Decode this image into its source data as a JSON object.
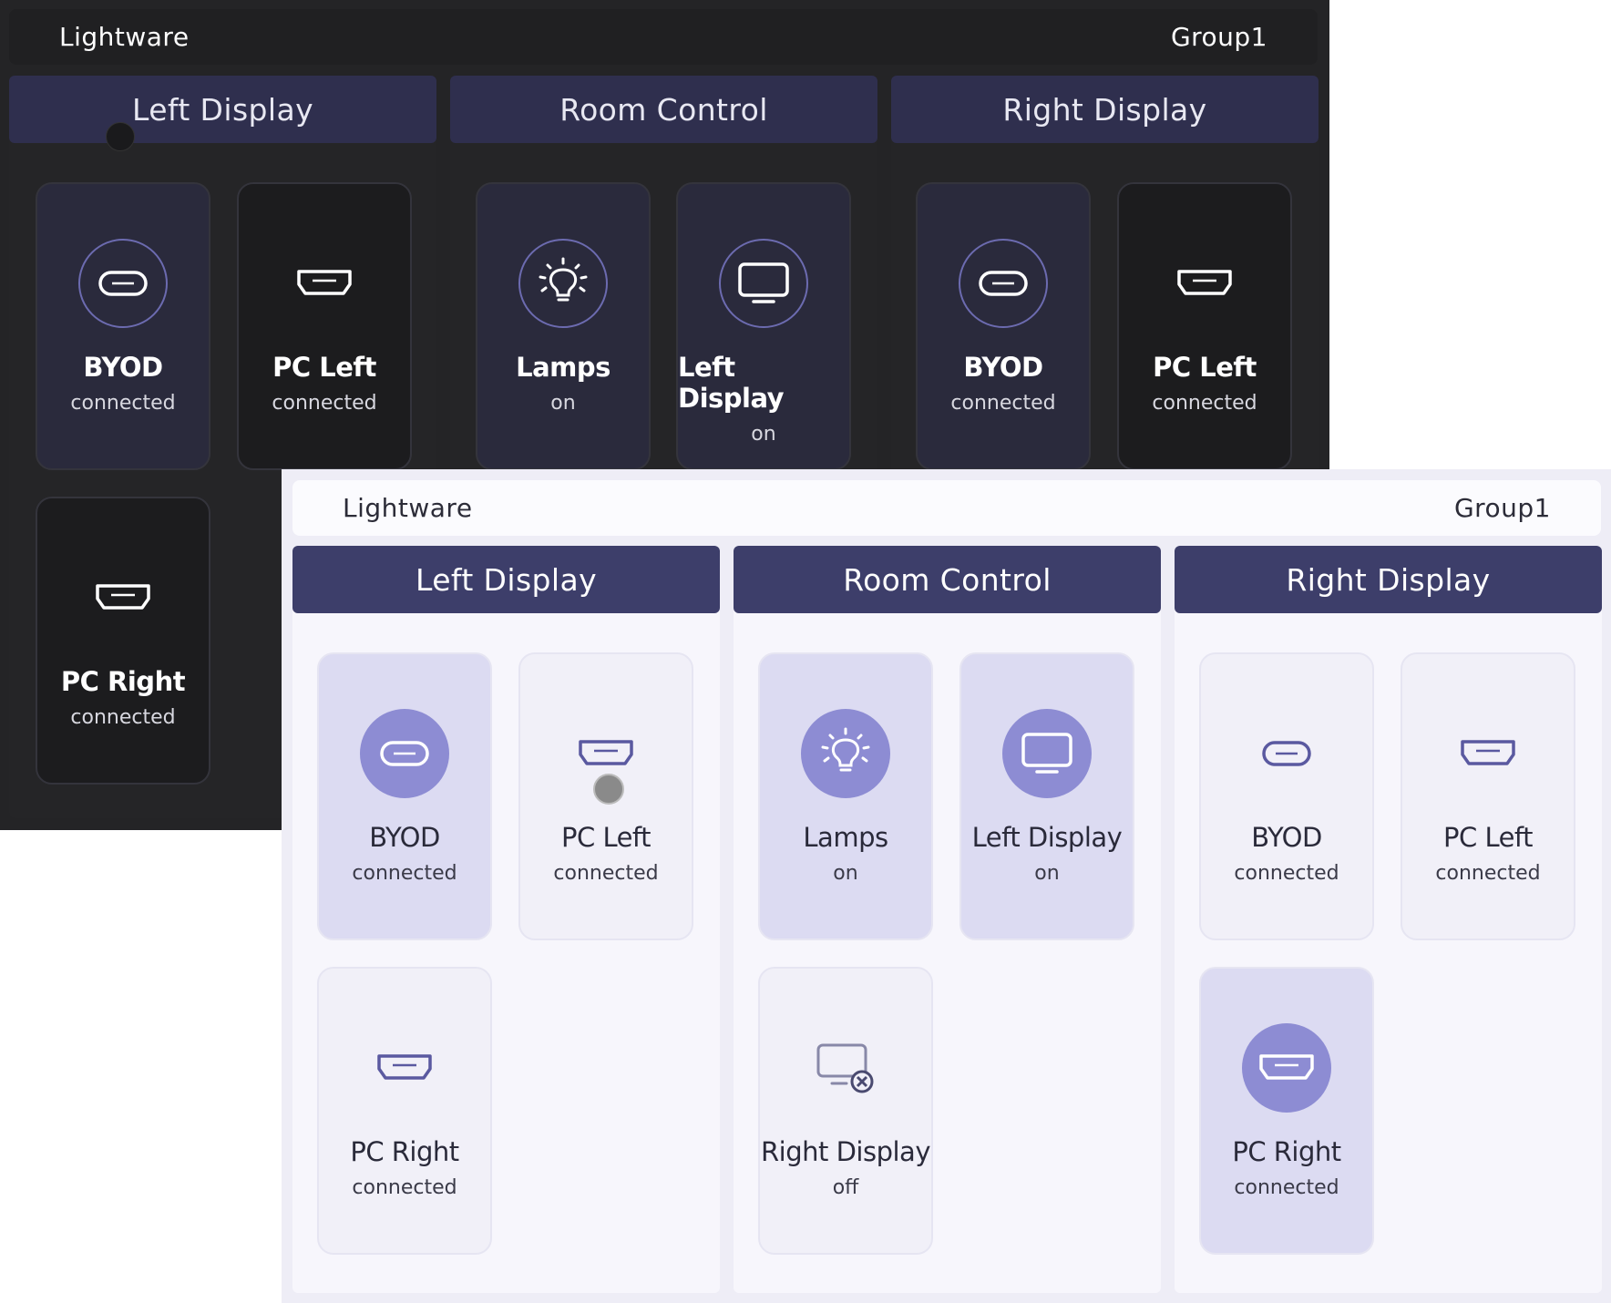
{
  "dark": {
    "brand": "Lightware",
    "group": "Group1",
    "columns": [
      {
        "title": "Left Display",
        "tiles": [
          {
            "name": "BYOD",
            "status": "connected",
            "icon": "usb-c-icon",
            "active": true
          },
          {
            "name": "PC Left",
            "status": "connected",
            "icon": "hdmi-icon",
            "active": false
          },
          {
            "name": "PC Right",
            "status": "connected",
            "icon": "hdmi-icon",
            "active": false
          }
        ]
      },
      {
        "title": "Room Control",
        "tiles": [
          {
            "name": "Lamps",
            "status": "on",
            "icon": "bulb-icon",
            "active": true
          },
          {
            "name": "Left Display",
            "status": "on",
            "icon": "monitor-icon",
            "active": true
          }
        ]
      },
      {
        "title": "Right Display",
        "tiles": [
          {
            "name": "BYOD",
            "status": "connected",
            "icon": "usb-c-icon",
            "active": true
          },
          {
            "name": "PC Left",
            "status": "connected",
            "icon": "hdmi-icon",
            "active": false
          }
        ]
      }
    ]
  },
  "light": {
    "brand": "Lightware",
    "group": "Group1",
    "columns": [
      {
        "title": "Left Display",
        "tiles": [
          {
            "name": "BYOD",
            "status": "connected",
            "icon": "usb-c-icon",
            "active": true
          },
          {
            "name": "PC Left",
            "status": "connected",
            "icon": "hdmi-icon",
            "active": false
          },
          {
            "name": "PC Right",
            "status": "connected",
            "icon": "hdmi-icon",
            "active": false
          }
        ]
      },
      {
        "title": "Room Control",
        "tiles": [
          {
            "name": "Lamps",
            "status": "on",
            "icon": "bulb-icon",
            "active": true
          },
          {
            "name": "Left Display",
            "status": "on",
            "icon": "monitor-icon",
            "active": true
          },
          {
            "name": "Right Display",
            "status": "off",
            "icon": "monitor-off-icon",
            "active": false
          }
        ]
      },
      {
        "title": "Right Display",
        "tiles": [
          {
            "name": "BYOD",
            "status": "connected",
            "icon": "usb-c-icon",
            "active": false
          },
          {
            "name": "PC Left",
            "status": "connected",
            "icon": "hdmi-icon",
            "active": false
          },
          {
            "name": "PC Right",
            "status": "connected",
            "icon": "hdmi-icon",
            "active": true
          }
        ]
      }
    ]
  },
  "colors": {
    "dark_bg": "#242426",
    "dark_header": "#2f2f4e",
    "light_bg": "#eeedf6",
    "light_header": "#3d3e6a",
    "accent": "#8d8cd3",
    "icon_dark": "#ffffff",
    "icon_light": "#5a59a0"
  }
}
